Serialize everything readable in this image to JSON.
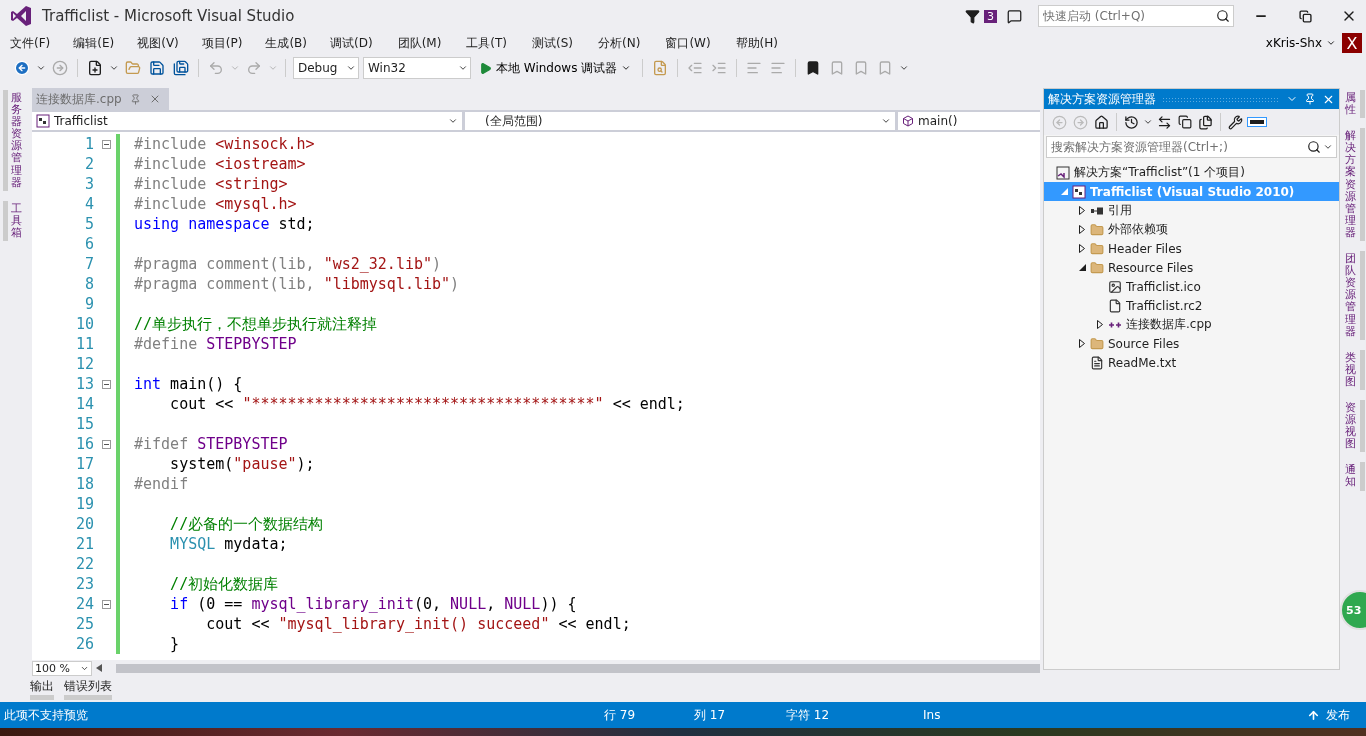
{
  "title_bar": {
    "title": "Trafficlist - Microsoft Visual Studio",
    "notification_count": "3",
    "quick_launch": {
      "placeholder": "快速启动 (Ctrl+Q)"
    }
  },
  "menu": [
    "文件(F)",
    "编辑(E)",
    "视图(V)",
    "项目(P)",
    "生成(B)",
    "调试(D)",
    "团队(M)",
    "工具(T)",
    "测试(S)",
    "分析(N)",
    "窗口(W)",
    "帮助(H)"
  ],
  "account": {
    "user": "xKris-Shx",
    "avatar": "X"
  },
  "toolbar": {
    "configuration": "Debug",
    "platform": "Win32",
    "run_label": "本地 Windows 调试器"
  },
  "left_tabs": [
    "服务器资源管理器",
    "工具箱"
  ],
  "editor": {
    "tab": {
      "label": "连接数据库.cpp"
    },
    "nav": [
      "Trafficlist",
      "(全局范围)",
      "main()"
    ],
    "zoom": "100 %",
    "lines": [
      {
        "n": "1",
        "fold": true,
        "tokens": [
          {
            "kind": "pre",
            "text": "#include "
          },
          {
            "kind": "str",
            "text": "<winsock.h>"
          }
        ]
      },
      {
        "n": "2",
        "tokens": [
          {
            "kind": "pre",
            "text": "#include "
          },
          {
            "kind": "str",
            "text": "<iostream>"
          }
        ]
      },
      {
        "n": "3",
        "tokens": [
          {
            "kind": "pre",
            "text": "#include "
          },
          {
            "kind": "str",
            "text": "<string>"
          }
        ]
      },
      {
        "n": "4",
        "tokens": [
          {
            "kind": "pre",
            "text": "#include "
          },
          {
            "kind": "str",
            "text": "<mysql.h>"
          }
        ]
      },
      {
        "n": "5",
        "tokens": [
          {
            "kind": "kw",
            "text": "using namespace"
          },
          {
            "kind": "plain",
            "text": " std;"
          }
        ]
      },
      {
        "n": "6"
      },
      {
        "n": "7",
        "tokens": [
          {
            "kind": "pre",
            "text": "#pragma comment(lib, "
          },
          {
            "kind": "str",
            "text": "\"ws2_32.lib\""
          },
          {
            "kind": "pre",
            "text": ")"
          }
        ]
      },
      {
        "n": "8",
        "tokens": [
          {
            "kind": "pre",
            "text": "#pragma comment(lib, "
          },
          {
            "kind": "str",
            "text": "\"libmysql.lib\""
          },
          {
            "kind": "pre",
            "text": ")"
          }
        ]
      },
      {
        "n": "9"
      },
      {
        "n": "10",
        "tokens": [
          {
            "kind": "com",
            "text": "//单步执行，不想单步执行就注释掉"
          }
        ]
      },
      {
        "n": "11",
        "tokens": [
          {
            "kind": "pre",
            "text": "#define "
          },
          {
            "kind": "mac",
            "text": "STEPBYSTEP"
          }
        ]
      },
      {
        "n": "12"
      },
      {
        "n": "13",
        "fold": true,
        "tokens": [
          {
            "kind": "kw",
            "text": "int"
          },
          {
            "kind": "plain",
            "text": " main() {"
          }
        ]
      },
      {
        "n": "14",
        "tokens": [
          {
            "kind": "plain",
            "text": "    cout << "
          },
          {
            "kind": "str",
            "text": "\"**************************************\""
          },
          {
            "kind": "plain",
            "text": " << endl;"
          }
        ]
      },
      {
        "n": "15"
      },
      {
        "n": "16",
        "fold": true,
        "tokens": [
          {
            "kind": "pre",
            "text": "#ifdef "
          },
          {
            "kind": "mac",
            "text": "STEPBYSTEP"
          }
        ]
      },
      {
        "n": "17",
        "tokens": [
          {
            "kind": "plain",
            "text": "    system("
          },
          {
            "kind": "str",
            "text": "\"pause\""
          },
          {
            "kind": "plain",
            "text": ");"
          }
        ]
      },
      {
        "n": "18",
        "tokens": [
          {
            "kind": "pre",
            "text": "#endif"
          }
        ]
      },
      {
        "n": "19"
      },
      {
        "n": "20",
        "tokens": [
          {
            "kind": "com",
            "text": "    //必备的一个数据结构"
          }
        ]
      },
      {
        "n": "21",
        "tokens": [
          {
            "kind": "type",
            "text": "    MYSQL"
          },
          {
            "kind": "plain",
            "text": " mydata;"
          }
        ]
      },
      {
        "n": "22"
      },
      {
        "n": "23",
        "tokens": [
          {
            "kind": "com",
            "text": "    //初始化数据库"
          }
        ]
      },
      {
        "n": "24",
        "fold": true,
        "tokens": [
          {
            "kind": "kw",
            "text": "    if"
          },
          {
            "kind": "plain",
            "text": " (0 == "
          },
          {
            "kind": "mac",
            "text": "mysql_library_init"
          },
          {
            "kind": "plain",
            "text": "(0, "
          },
          {
            "kind": "mac",
            "text": "NULL"
          },
          {
            "kind": "plain",
            "text": ", "
          },
          {
            "kind": "mac",
            "text": "NULL"
          },
          {
            "kind": "plain",
            "text": ")) {"
          }
        ]
      },
      {
        "n": "25",
        "tokens": [
          {
            "kind": "plain",
            "text": "        cout << "
          },
          {
            "kind": "str",
            "text": "\"mysql_library_init() succeed\""
          },
          {
            "kind": "plain",
            "text": " << endl;"
          }
        ]
      },
      {
        "n": "26",
        "tokens": [
          {
            "kind": "plain",
            "text": "    }"
          }
        ]
      }
    ]
  },
  "solution_explorer": {
    "title": "解决方案资源管理器",
    "search": {
      "placeholder": "搜索解决方案资源管理器(Ctrl+;)"
    },
    "tree": [
      {
        "kind": "solution",
        "label": "解决方案“Trafficlist”(1 个项目)",
        "selected": false,
        "children": [
          {
            "kind": "project",
            "label": "Trafficlist (Visual Studio 2010)",
            "selected": true,
            "expanded": true,
            "children": [
              {
                "kind": "references",
                "label": "引用",
                "selected": false,
                "expanded": false
              },
              {
                "kind": "external",
                "label": "外部依赖项",
                "selected": false,
                "expanded": false
              },
              {
                "kind": "filter",
                "label": "Header Files",
                "selected": false,
                "expanded": false
              },
              {
                "kind": "filter",
                "label": "Resource Files",
                "selected": false,
                "expanded": true,
                "children": [
                  {
                    "kind": "image",
                    "label": "Trafficlist.ico",
                    "selected": false
                  },
                  {
                    "kind": "file",
                    "label": "Trafficlist.rc2",
                    "selected": false
                  },
                  {
                    "kind": "cpp",
                    "label": "连接数据库.cpp",
                    "selected": false,
                    "expanded": false
                  }
                ]
              },
              {
                "kind": "filter",
                "label": "Source Files",
                "selected": false,
                "expanded": false
              },
              {
                "kind": "text",
                "label": "ReadMe.txt",
                "selected": false
              }
            ]
          }
        ]
      }
    ]
  },
  "right_tabs": [
    "属性",
    "解决方案资源管理器",
    "团队资源管理器",
    "类视图",
    "资源视图",
    "通知"
  ],
  "floating_badge": "53",
  "bottom_tabs": [
    "输出",
    "错误列表"
  ],
  "status_bar": {
    "message": "此项不支持预览",
    "line": "行 79",
    "column": "列 17",
    "char": "字符 12",
    "mode": "Ins",
    "publish": "发布"
  }
}
